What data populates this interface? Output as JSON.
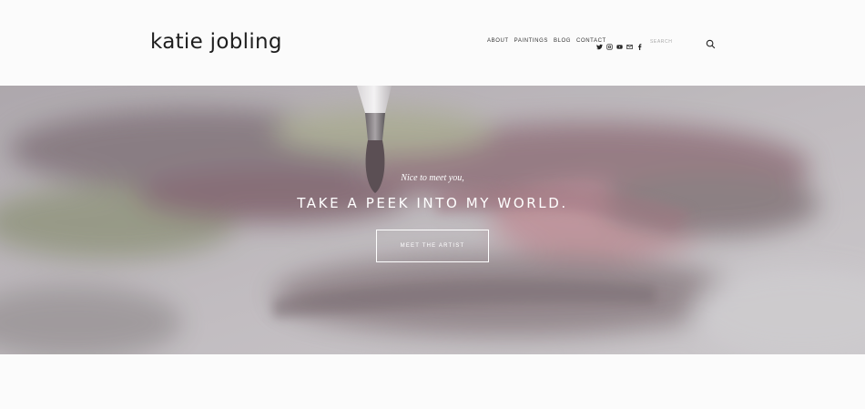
{
  "site": {
    "logo": "katie jobling"
  },
  "nav": {
    "items": [
      {
        "label": "ABOUT"
      },
      {
        "label": "PAINTINGS"
      },
      {
        "label": "BLOG"
      },
      {
        "label": "CONTACT"
      }
    ]
  },
  "social": {
    "icons": [
      "twitter-icon",
      "instagram-icon",
      "youtube-icon",
      "mail-icon",
      "facebook-icon"
    ]
  },
  "search": {
    "placeholder": "SEARCH",
    "value": ""
  },
  "hero": {
    "subtitle": "Nice to meet you,",
    "title": "TAKE A PEEK INTO MY WORLD.",
    "button_label": "MEET THE ARTIST"
  },
  "colors": {
    "text": "#1e1e1e",
    "background": "#fbfbfb",
    "hero_overlay_text": "#ffffff"
  }
}
